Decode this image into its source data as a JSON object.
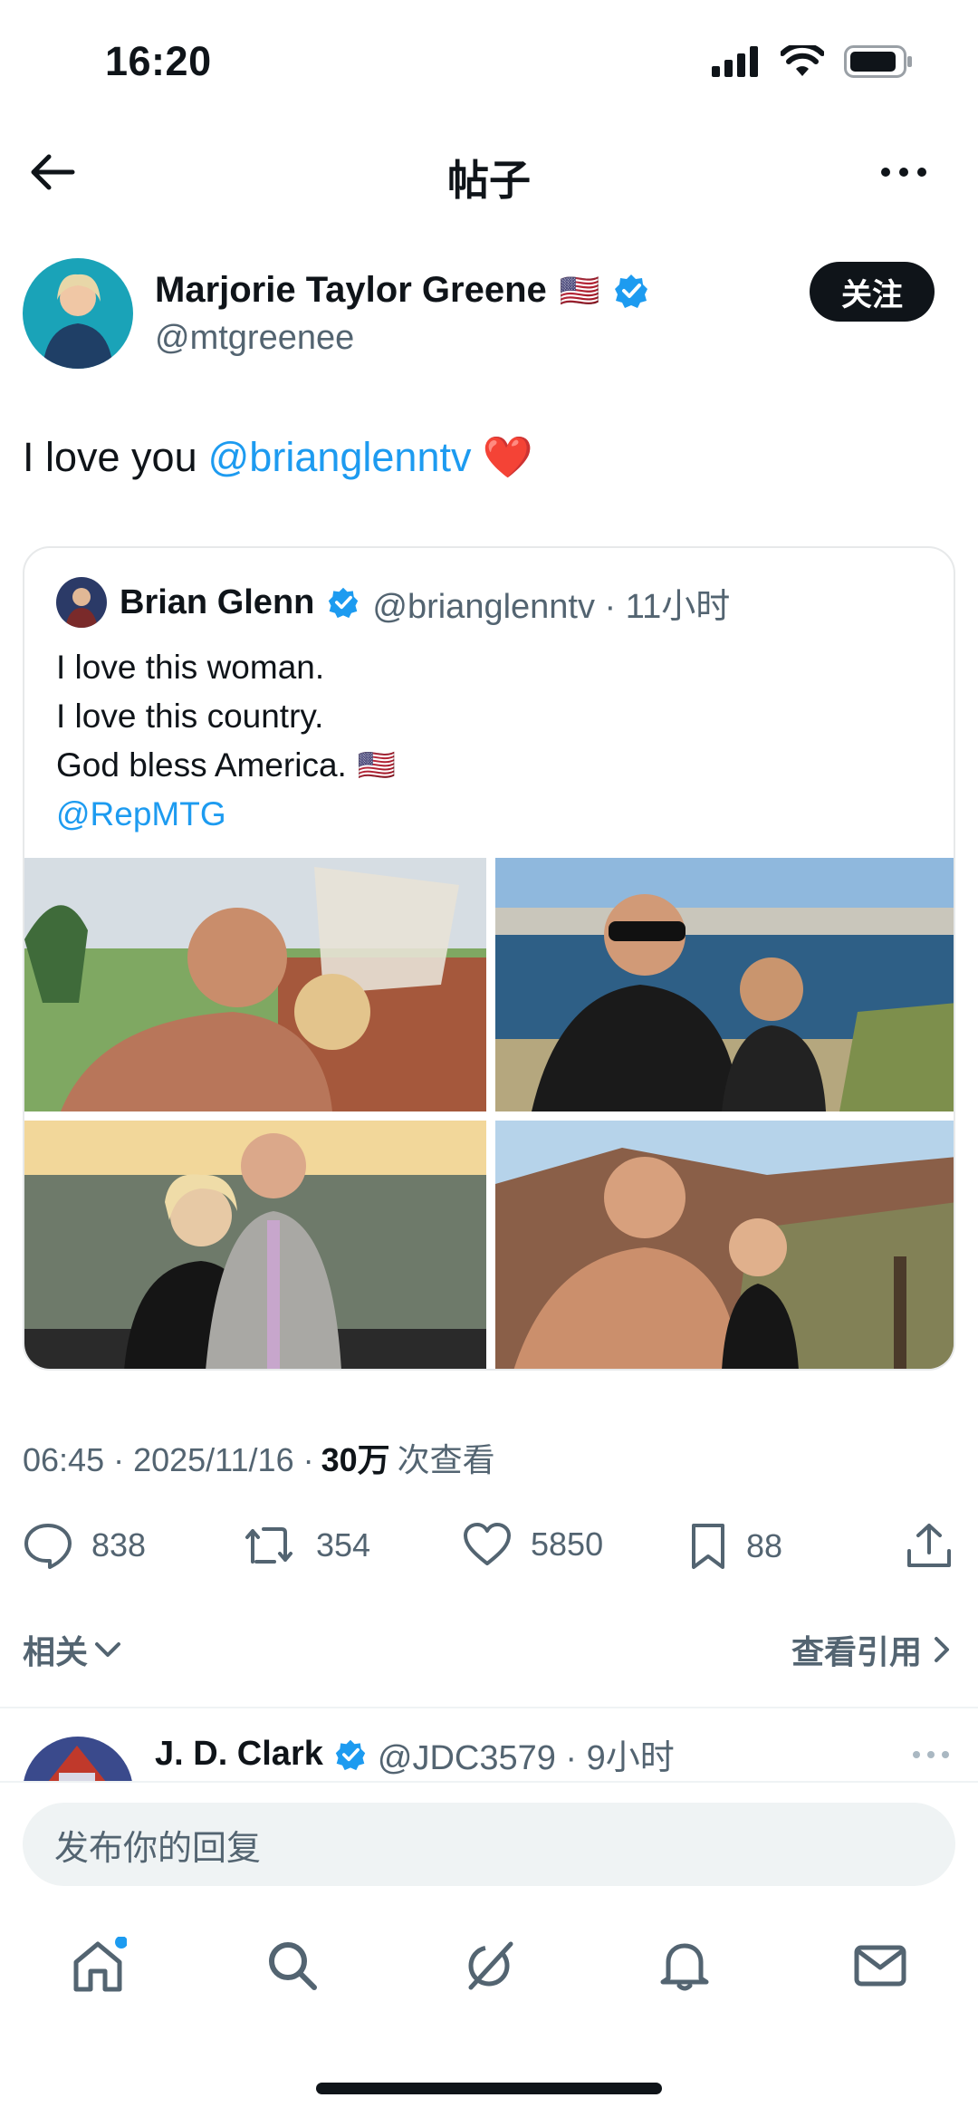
{
  "status_bar": {
    "time": "16:20"
  },
  "header": {
    "title": "帖子"
  },
  "author": {
    "name": "Marjorie Taylor Greene",
    "flag": "🇺🇸",
    "handle": "@mtgreenee",
    "follow_label": "关注"
  },
  "tweet": {
    "text": "I love you",
    "mention": "@brianglenntv",
    "emoji": "❤️"
  },
  "quoted": {
    "name": "Brian Glenn",
    "meta": "@brianglenntv · 11小时",
    "lines": [
      "I love this woman.",
      "I love this country.",
      "God bless America."
    ],
    "flag": "🇺🇸",
    "mention": "@RepMTG"
  },
  "timestamp": {
    "time_date": "06:45 · 2025/11/16 ·",
    "views_count": "30万",
    "views_label": "次查看"
  },
  "actions": {
    "replies": "838",
    "reposts": "354",
    "likes": "5850",
    "bookmarks": "88"
  },
  "related": {
    "related_label": "相关",
    "quotes_label": "查看引用"
  },
  "reply_peek": {
    "name": "J. D. Clark",
    "meta": "@JDC3579 · 9小时"
  },
  "composer": {
    "placeholder": "发布你的回复"
  },
  "colors": {
    "accent": "#1d9bf0",
    "text": "#0f1419",
    "muted": "#536471"
  }
}
